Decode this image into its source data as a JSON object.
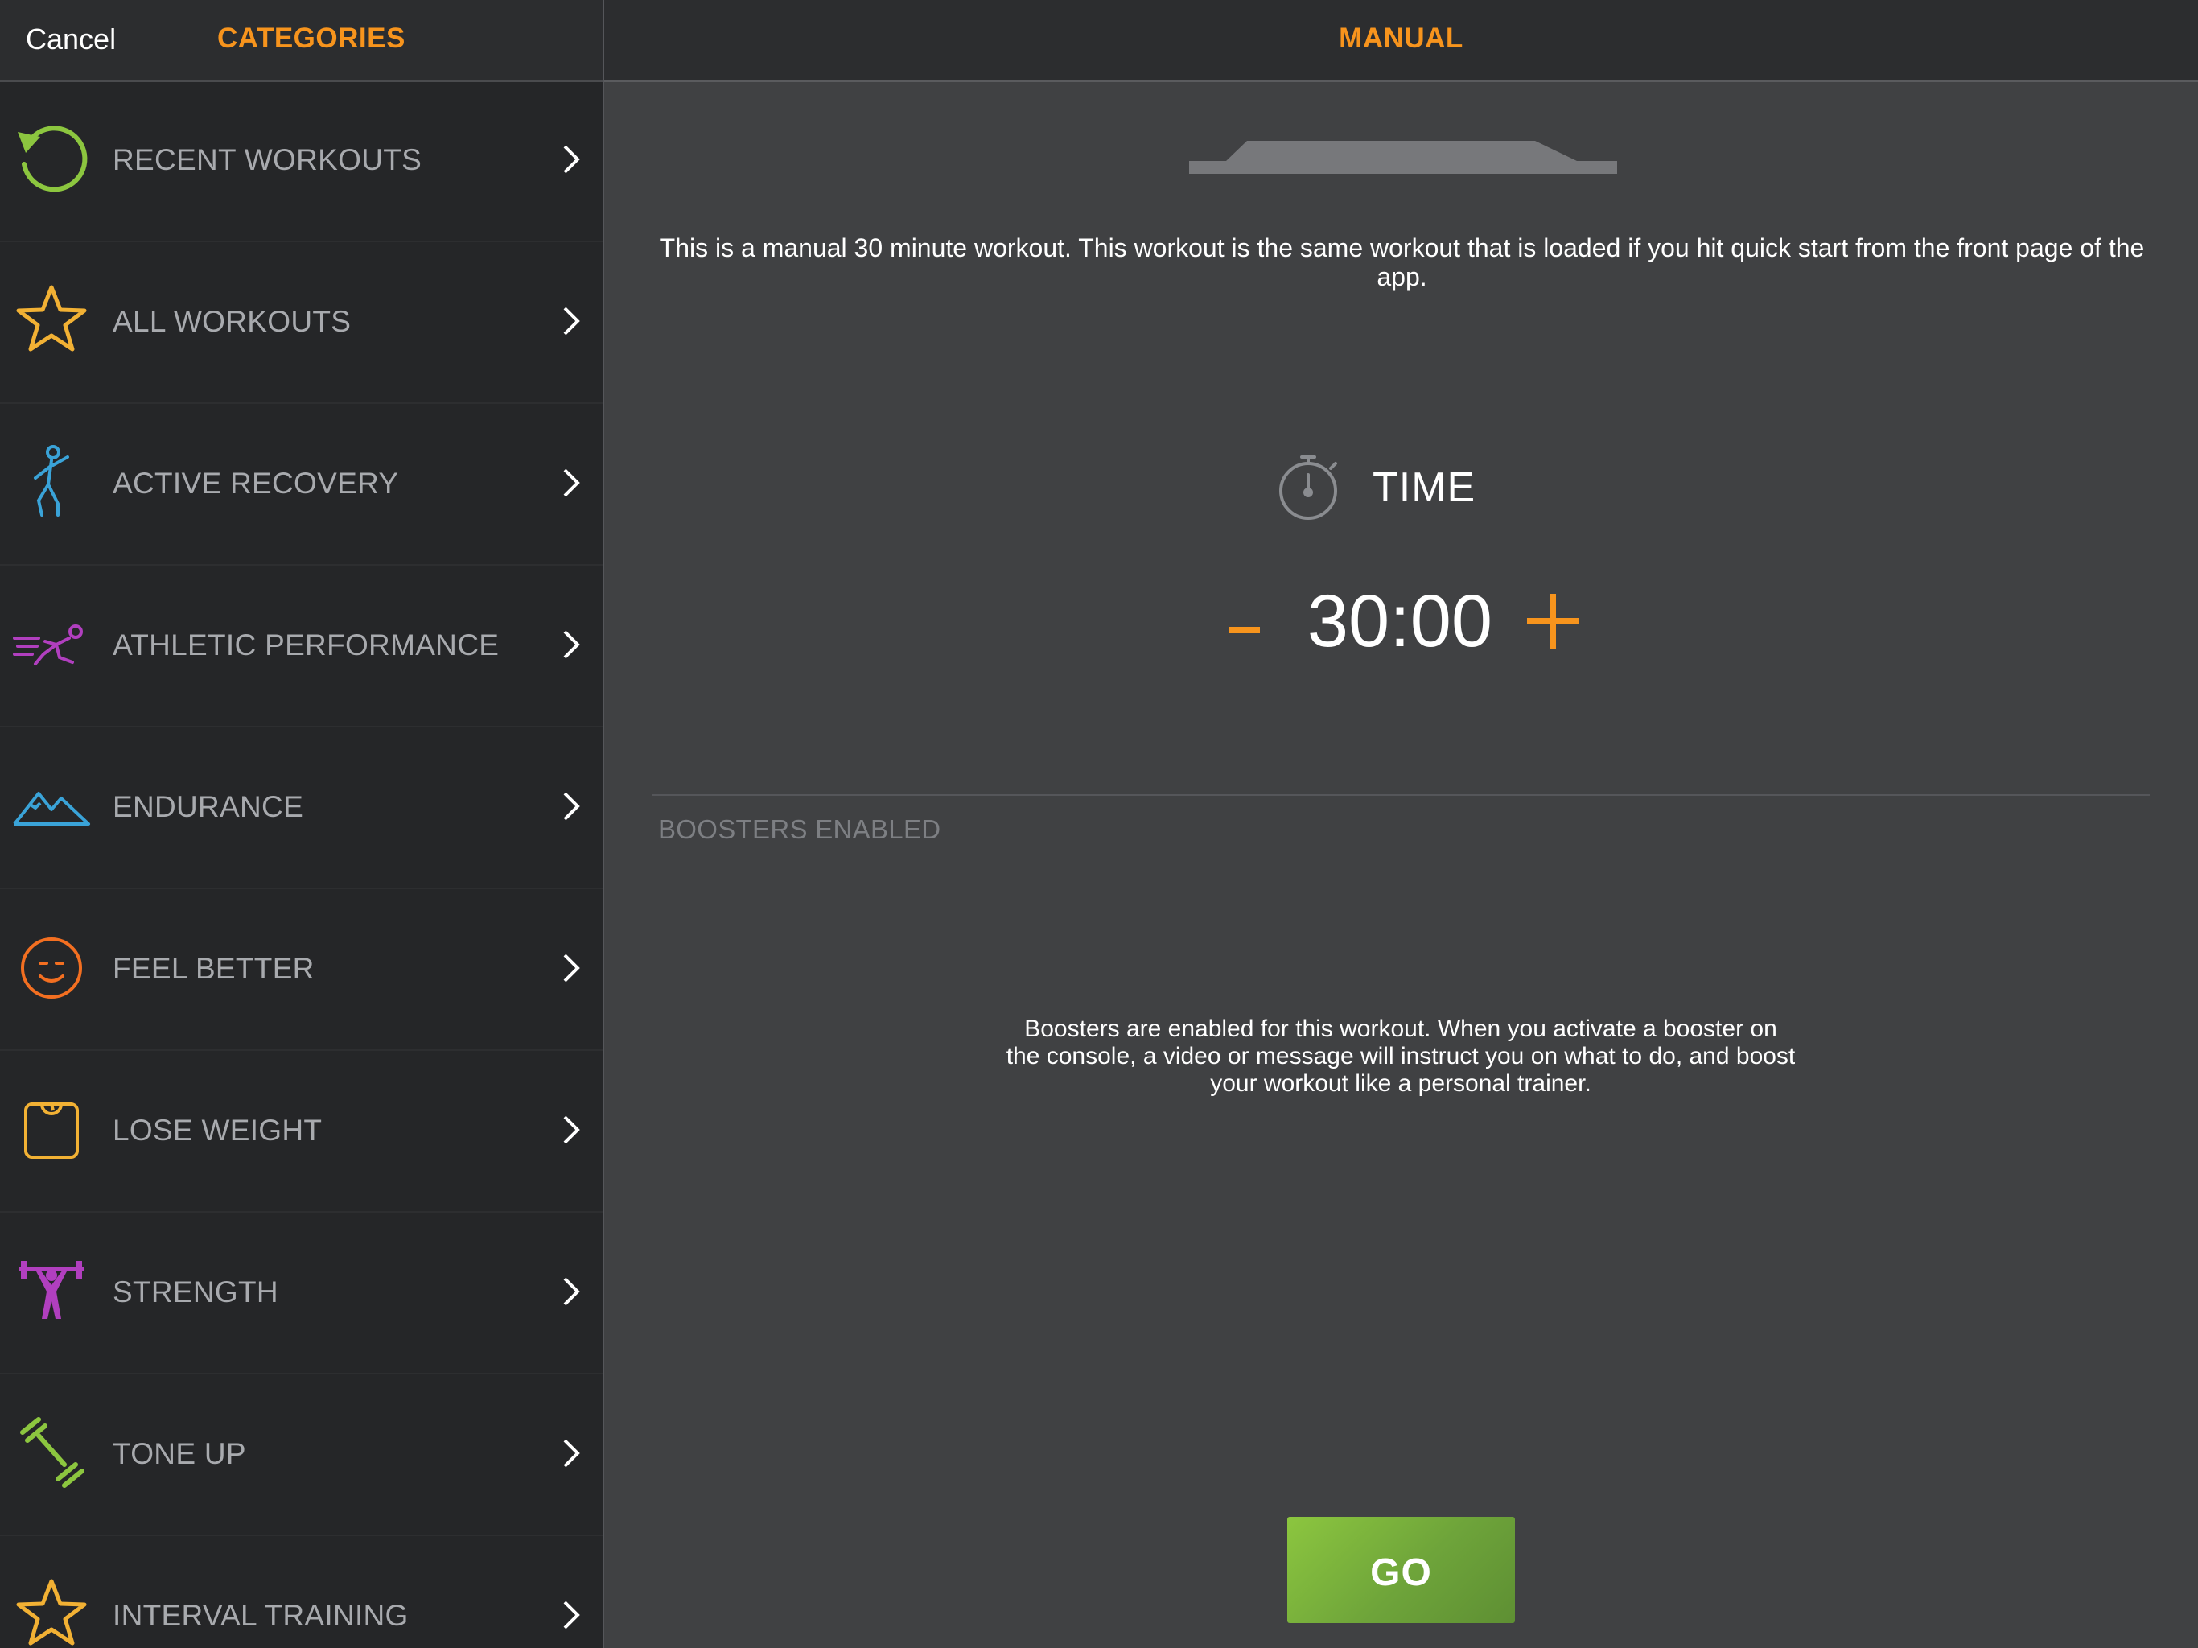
{
  "header": {
    "cancel_label": "Cancel",
    "categories_title": "CATEGORIES",
    "detail_title": "MANUAL"
  },
  "categories": [
    {
      "label": "RECENT WORKOUTS",
      "icon": "history-icon",
      "color": "#8cc63f"
    },
    {
      "label": "ALL WORKOUTS",
      "icon": "star-icon",
      "color": "#f2b134"
    },
    {
      "label": "ACTIVE RECOVERY",
      "icon": "stretching-person-icon",
      "color": "#3aa3d8"
    },
    {
      "label": "ATHLETIC PERFORMANCE",
      "icon": "sprinter-icon",
      "color": "#b13fbf"
    },
    {
      "label": "ENDURANCE",
      "icon": "mountains-icon",
      "color": "#3aa3d8"
    },
    {
      "label": "FEEL BETTER",
      "icon": "smiling-face-icon",
      "color": "#f36f21"
    },
    {
      "label": "LOSE WEIGHT",
      "icon": "scale-icon",
      "color": "#f2b134"
    },
    {
      "label": "STRENGTH",
      "icon": "weightlifter-icon",
      "color": "#b13fbf"
    },
    {
      "label": "TONE UP",
      "icon": "dumbbell-icon",
      "color": "#8cc63f"
    },
    {
      "label": "INTERVAL TRAINING",
      "icon": "star-icon",
      "color": "#f2b134"
    }
  ],
  "workout": {
    "description": "This is a manual 30 minute workout. This workout is the same workout that is loaded if you hit quick start from the front page of the app.",
    "time_label": "TIME",
    "time_value": "30:00",
    "boosters_title": "BOOSTERS ENABLED",
    "boosters_description": "Boosters are enabled for this workout. When you activate a booster on the console, a video or message will instruct you on what to do, and boost your workout like a personal trainer.",
    "go_label": "GO"
  },
  "colors": {
    "accent": "#f7941d",
    "go_button": "#7ab33e",
    "panel_dark": "#252628",
    "panel_right": "#404143"
  }
}
